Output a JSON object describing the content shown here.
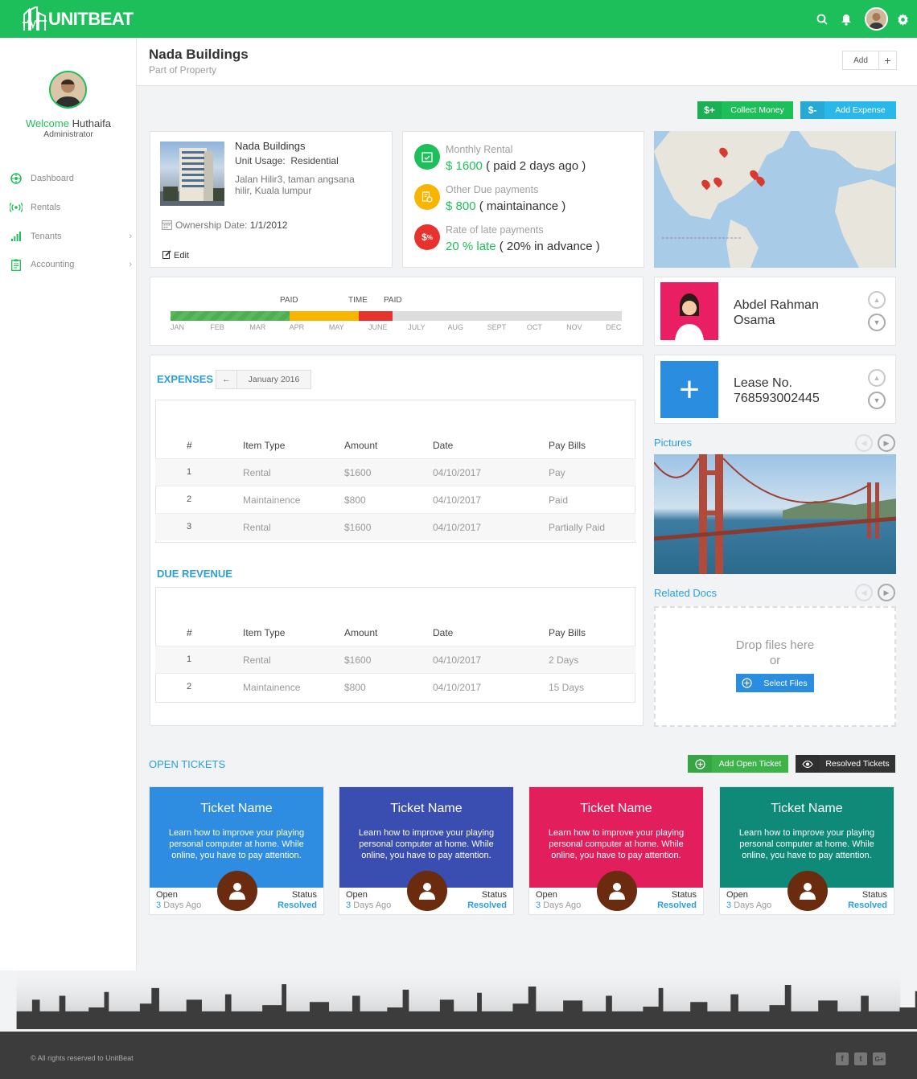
{
  "app": {
    "logo_text": "UNITBEAT"
  },
  "topbar": {
    "icons": [
      "search-icon",
      "bell-icon",
      "avatar",
      "gear-icon"
    ]
  },
  "sidebar": {
    "welcome_prefix": "Welcome",
    "user_name": "Huthaifa",
    "role": "Administrator",
    "items": [
      {
        "label": "Dashboard",
        "icon": "dashboard-icon"
      },
      {
        "label": "Rentals",
        "icon": "broadcast-icon"
      },
      {
        "label": "Tenants",
        "icon": "bar-chart-icon"
      },
      {
        "label": "Accounting",
        "icon": "clipboard-icon"
      }
    ]
  },
  "header": {
    "title": "Nada Buildings",
    "subtitle": "Part of Property",
    "add_label": "Add",
    "add_plus": "+"
  },
  "actions": {
    "collect": {
      "icon": "$+",
      "label": "Collect Money",
      "color": "#1dbf5b"
    },
    "expense": {
      "icon": "$-",
      "label": "Add Expense",
      "color": "#2ab8e8"
    }
  },
  "property": {
    "name": "Nada Buildings",
    "usage_label": "Unit Usage:",
    "usage": "Residential",
    "address": "Jalan Hilir3, taman angsana hilir, Kuala lumpur",
    "ownership_label": "Ownership Date:",
    "ownership_date": "1/1/2012",
    "edit_label": "Edit"
  },
  "stats": [
    {
      "label": "Monthly Rental",
      "value": "$ 1600",
      "extra": "( paid 2 days ago )",
      "color": "#1dbf5b",
      "icon": "calendar-check-icon"
    },
    {
      "label": "Other Due payments",
      "value": "$ 800",
      "extra": "( maintainance )",
      "color": "#f7b500",
      "icon": "receipt-clock-icon"
    },
    {
      "label": "Rate of late payments",
      "value": "20 % late",
      "extra": "( 20% in advance )",
      "color": "#e8322e",
      "icon": "dollar-percent-icon"
    }
  ],
  "timeline": {
    "labels": [
      "PAID",
      "TIME",
      "PAID"
    ],
    "months": [
      "JAN",
      "FEB",
      "MAR",
      "APR",
      "MAY",
      "JUNE",
      "JULY",
      "AUG",
      "SEPT",
      "OCT",
      "NOV",
      "DEC"
    ],
    "segments": [
      {
        "status": "paid",
        "from_month": 0,
        "to_month": 3,
        "color": "#5cb85c"
      },
      {
        "status": "on-time",
        "from_month": 3,
        "to_month": 4.75,
        "color": "#f7b500"
      },
      {
        "status": "late",
        "from_month": 4.75,
        "to_month": 5.6,
        "color": "#e8322e"
      }
    ]
  },
  "tenant": {
    "name": "Abdel Rahman Osama",
    "photo_bg": "#e91e63"
  },
  "lease": {
    "label": "Lease No.",
    "number": "768593002445",
    "tile_bg": "#2a8de0"
  },
  "expenses": {
    "title": "EXPENSES",
    "back_icon": "←",
    "period": "January 2016",
    "columns": [
      "#",
      "Item Type",
      "Amount",
      "Date",
      "Pay Bills"
    ],
    "rows": [
      [
        "1",
        "Rental",
        "$1600",
        "04/10/2017",
        "Pay"
      ],
      [
        "2",
        "Maintainence",
        "$800",
        "04/10/2017",
        "Paid"
      ],
      [
        "3",
        "Rental",
        "$1600",
        "04/10/2017",
        "Partially Paid"
      ]
    ]
  },
  "due": {
    "title": "DUE REVENUE",
    "columns": [
      "#",
      "Item Type",
      "Amount",
      "Date",
      "Pay Bills"
    ],
    "rows": [
      [
        "1",
        "Rental",
        "$1600",
        "04/10/2017",
        "2 Days"
      ],
      [
        "2",
        "Maintainence",
        "$800",
        "04/10/2017",
        "15 Days"
      ]
    ]
  },
  "pictures": {
    "title": "Pictures"
  },
  "docs": {
    "title": "Related Docs",
    "drop_text": "Drop files here",
    "or": "or",
    "select_label": "Select Files"
  },
  "tickets": {
    "title": "OPEN TICKETS",
    "add_label": "Add Open Ticket",
    "resolved_label": "Resolved Tickets",
    "items": [
      {
        "name": "Ticket Name",
        "desc": "Learn how to improve your playing personal computer at home. While online, you have to pay attention.",
        "open": "Open",
        "days": "3",
        "ago": "Days Ago",
        "status_label": "Status",
        "status": "Resolved",
        "color": "#2e8de0"
      },
      {
        "name": "Ticket Name",
        "desc": "Learn how to improve your playing personal computer at home. While online, you have to pay attention.",
        "open": "Open",
        "days": "3",
        "ago": "Days Ago",
        "status_label": "Status",
        "status": "Resolved",
        "color": "#3a4db0"
      },
      {
        "name": "Ticket Name",
        "desc": "Learn how to improve your playing personal computer at home. While online, you have to pay attention.",
        "open": "Open",
        "days": "3",
        "ago": "Days Ago",
        "status_label": "Status",
        "status": "Resolved",
        "color": "#e31e5c"
      },
      {
        "name": "Ticket Name",
        "desc": "Learn how to improve your playing personal computer at home. While online, you have to pay attention.",
        "open": "Open",
        "days": "3",
        "ago": "Days Ago",
        "status_label": "Status",
        "status": "Resolved",
        "color": "#0f8a78"
      }
    ]
  },
  "footer": {
    "copyright": "© All rights reserved to UnitBeat",
    "social": [
      "f",
      "t",
      "G+"
    ]
  }
}
